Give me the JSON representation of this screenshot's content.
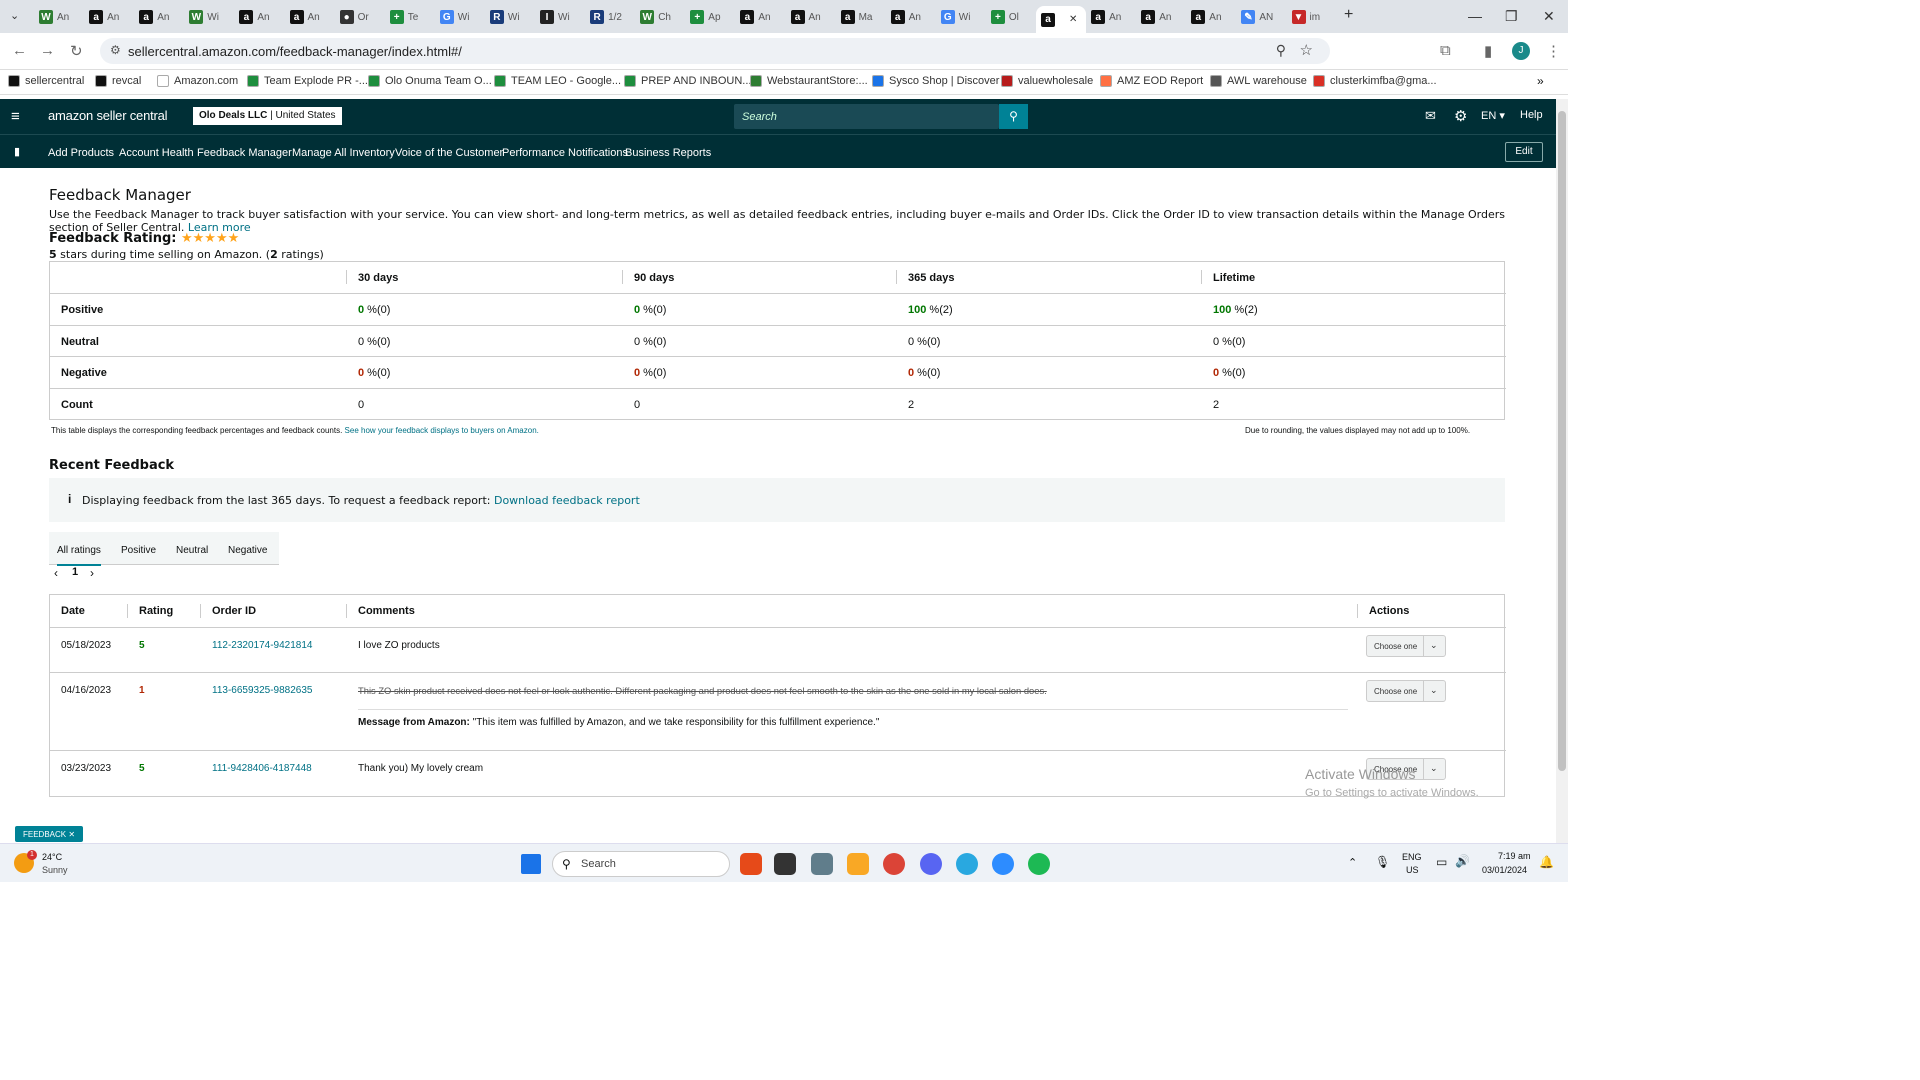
{
  "browser": {
    "tabs": [
      {
        "label": "An",
        "color": "#2e7d32",
        "glyph": "W"
      },
      {
        "label": "An",
        "color": "#111",
        "glyph": "a"
      },
      {
        "label": "An",
        "color": "#111",
        "glyph": "a"
      },
      {
        "label": "Wi",
        "color": "#2e7d32",
        "glyph": "W"
      },
      {
        "label": "An",
        "color": "#111",
        "glyph": "a"
      },
      {
        "label": "An",
        "color": "#111",
        "glyph": "a"
      },
      {
        "label": "Or",
        "color": "#333",
        "glyph": "●"
      },
      {
        "label": "Te",
        "color": "#1e8e3e",
        "glyph": "+"
      },
      {
        "label": "Wi",
        "color": "#4285f4",
        "glyph": "G"
      },
      {
        "label": "Wi",
        "color": "#1a3c7a",
        "glyph": "R"
      },
      {
        "label": "Wi",
        "color": "#222",
        "glyph": "I"
      },
      {
        "label": "1/2",
        "color": "#1a3c7a",
        "glyph": "R"
      },
      {
        "label": "Ch",
        "color": "#2e7d32",
        "glyph": "W"
      },
      {
        "label": "Ap",
        "color": "#1e8e3e",
        "glyph": "+"
      },
      {
        "label": "An",
        "color": "#111",
        "glyph": "a"
      },
      {
        "label": "An",
        "color": "#111",
        "glyph": "a"
      },
      {
        "label": "Ma",
        "color": "#111",
        "glyph": "a"
      },
      {
        "label": "An",
        "color": "#111",
        "glyph": "a"
      },
      {
        "label": "Wi",
        "color": "#4285f4",
        "glyph": "G"
      },
      {
        "label": "Ol",
        "color": "#1e8e3e",
        "glyph": "+"
      },
      {
        "label": "",
        "color": "#111",
        "glyph": "a"
      },
      {
        "label": "An",
        "color": "#111",
        "glyph": "a"
      },
      {
        "label": "An",
        "color": "#111",
        "glyph": "a"
      },
      {
        "label": "An",
        "color": "#111",
        "glyph": "a"
      },
      {
        "label": "AN",
        "color": "#4285f4",
        "glyph": "✎"
      },
      {
        "label": "im",
        "color": "#c62828",
        "glyph": "▼"
      }
    ],
    "new_tab": "+",
    "url": "sellercentral.amazon.com/feedback-manager/index.html#/",
    "bookmarks": [
      {
        "label": "sellercentral",
        "color": "#111"
      },
      {
        "label": "revcal",
        "color": "#111"
      },
      {
        "label": "Amazon.com",
        "color": "#fff"
      },
      {
        "label": "Team Explode PR -...",
        "color": "#1e8e3e"
      },
      {
        "label": "Olo Onuma Team O...",
        "color": "#1e8e3e"
      },
      {
        "label": "TEAM LEO - Google...",
        "color": "#1e8e3e"
      },
      {
        "label": "PREP AND INBOUN...",
        "color": "#1e8e3e"
      },
      {
        "label": "WebstaurantStore:...",
        "color": "#2e7d32"
      },
      {
        "label": "Sysco Shop | Discover",
        "color": "#1a73e8"
      },
      {
        "label": "valuewholesale",
        "color": "#b71c1c"
      },
      {
        "label": "AMZ EOD Report",
        "color": "#ff7043"
      },
      {
        "label": "AWL warehouse",
        "color": "#555"
      },
      {
        "label": "clusterkimfba@gma...",
        "color": "#d93025"
      }
    ]
  },
  "header": {
    "logo": "amazon seller central",
    "account": "Olo Deals LLC",
    "marketplace": "United States",
    "search_placeholder": "Search",
    "language": "EN",
    "help": "Help",
    "nav": [
      "Add Products",
      "Account Health",
      "Feedback Manager",
      "Manage All Inventory",
      "Voice of the Customer",
      "Performance Notifications",
      "Business Reports"
    ],
    "edit": "Edit"
  },
  "page": {
    "title": "Feedback Manager",
    "description": "Use the Feedback Manager to track buyer satisfaction with your service. You can view short- and long-term metrics, as well as detailed feedback entries, including buyer e-mails and Order IDs. Click the Order ID to view transaction details within the Manage Orders section of Seller Central.",
    "learn_more": "Learn more",
    "rating_label": "Feedback Rating:",
    "stars": "★★★★★",
    "rating_summary_prefix": "5",
    "rating_summary_mid": " stars during time selling on Amazon. (",
    "rating_count": "2",
    "rating_summary_suffix": " ratings)",
    "metrics": {
      "columns": [
        "30 days",
        "90 days",
        "365 days",
        "Lifetime"
      ],
      "rows": [
        {
          "label": "Positive",
          "cells": [
            {
              "v": "0",
              "s": " %(0)"
            },
            {
              "v": "0",
              "s": " %(0)"
            },
            {
              "v": "100",
              "s": " %(2)"
            },
            {
              "v": "100",
              "s": " %(2)"
            }
          ]
        },
        {
          "label": "Neutral",
          "cells": [
            {
              "v": "0",
              "s": " %(0)"
            },
            {
              "v": "0",
              "s": " %(0)"
            },
            {
              "v": "0",
              "s": " %(0)"
            },
            {
              "v": "0",
              "s": " %(0)"
            }
          ]
        },
        {
          "label": "Negative",
          "cells": [
            {
              "v": "0",
              "s": " %(0)"
            },
            {
              "v": "0",
              "s": " %(0)"
            },
            {
              "v": "0",
              "s": " %(0)"
            },
            {
              "v": "0",
              "s": " %(0)"
            }
          ]
        },
        {
          "label": "Count",
          "cells": [
            {
              "v": "",
              "s": "0"
            },
            {
              "v": "",
              "s": "0"
            },
            {
              "v": "",
              "s": "2"
            },
            {
              "v": "",
              "s": "2"
            }
          ]
        }
      ],
      "footnote": "This table displays the corresponding feedback percentages and feedback counts.",
      "footnote_link": "See how your feedback displays to buyers on Amazon.",
      "rounding_note": "Due to rounding, the values displayed may not add up to 100%."
    },
    "recent": {
      "title": "Recent Feedback",
      "info_text": "Displaying feedback from the last 365 days. To request a feedback report:",
      "info_link": "Download feedback report",
      "tabs": [
        "All ratings",
        "Positive",
        "Neutral",
        "Negative"
      ],
      "page": "1",
      "columns": [
        "Date",
        "Rating",
        "Order ID",
        "Comments",
        "Actions"
      ],
      "rows": [
        {
          "date": "05/18/2023",
          "rating": "5",
          "order": "112-2320174-9421814",
          "comment": "I love ZO products",
          "action": "Choose one"
        },
        {
          "date": "04/16/2023",
          "rating": "1",
          "order": "113-6659325-9882635",
          "comment": "This ZO skin product received does not feel or look authentic. Different packaging and product does not feel smooth to the skin as the one sold in my local salon does.",
          "amazon_label": "Message from Amazon:",
          "amazon_msg": " \"This item was fulfilled by Amazon, and we take responsibility for this fulfillment experience.\"",
          "action": "Choose one"
        },
        {
          "date": "03/23/2023",
          "rating": "5",
          "order": "111-9428406-4187448",
          "comment": "Thank you) My lovely cream",
          "action": "Choose one"
        }
      ]
    },
    "feedback_tab": "FEEDBACK",
    "watermark_title": "Activate Windows",
    "watermark_sub": "Go to Settings to activate Windows."
  },
  "taskbar": {
    "weather_temp": "24°C",
    "weather_desc": "Sunny",
    "weather_badge": "1",
    "search": "Search",
    "lang": "ENG",
    "region": "US",
    "time": "7:19 am",
    "date": "03/01/2024"
  }
}
